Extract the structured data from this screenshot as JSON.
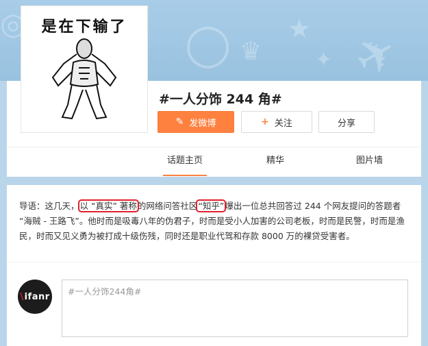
{
  "avatar": {
    "caption": "是在下输了",
    "icon": "meme-figure"
  },
  "topic": {
    "title": "#一人分饰 244 角#"
  },
  "actions": {
    "post_label": "发微博",
    "post_icon": "edit-icon",
    "follow_label": "关注",
    "follow_icon": "+",
    "share_label": "分享"
  },
  "tabs": [
    {
      "label": "话题主页",
      "active": true
    },
    {
      "label": "精华",
      "active": false
    },
    {
      "label": "图片墙",
      "active": false
    }
  ],
  "intro": {
    "prefix": "导语：这几天，",
    "hl1": "以 “真实” 著称",
    "mid": "的网络问答社区",
    "hl2": "“知乎”",
    "rest": "爆出一位总共回答过 244 个网友提问的答题者 “海贼 - 王路飞”。他时而是吸毒八年的伪君子，时而是受小人加害的公司老板，时而是民警，时而是渔民，时而又见义勇为被打成十级伤残，同时还是职业代驾和存款 8000 万的裸贷受害者。"
  },
  "composer": {
    "avatar_text": "ifanr",
    "avatar_mark": "\\",
    "input_value": "#一人分饰244角#"
  },
  "colors": {
    "accent": "#ff8140",
    "highlight": "#e0212e",
    "banner": "#9ec6e2"
  }
}
